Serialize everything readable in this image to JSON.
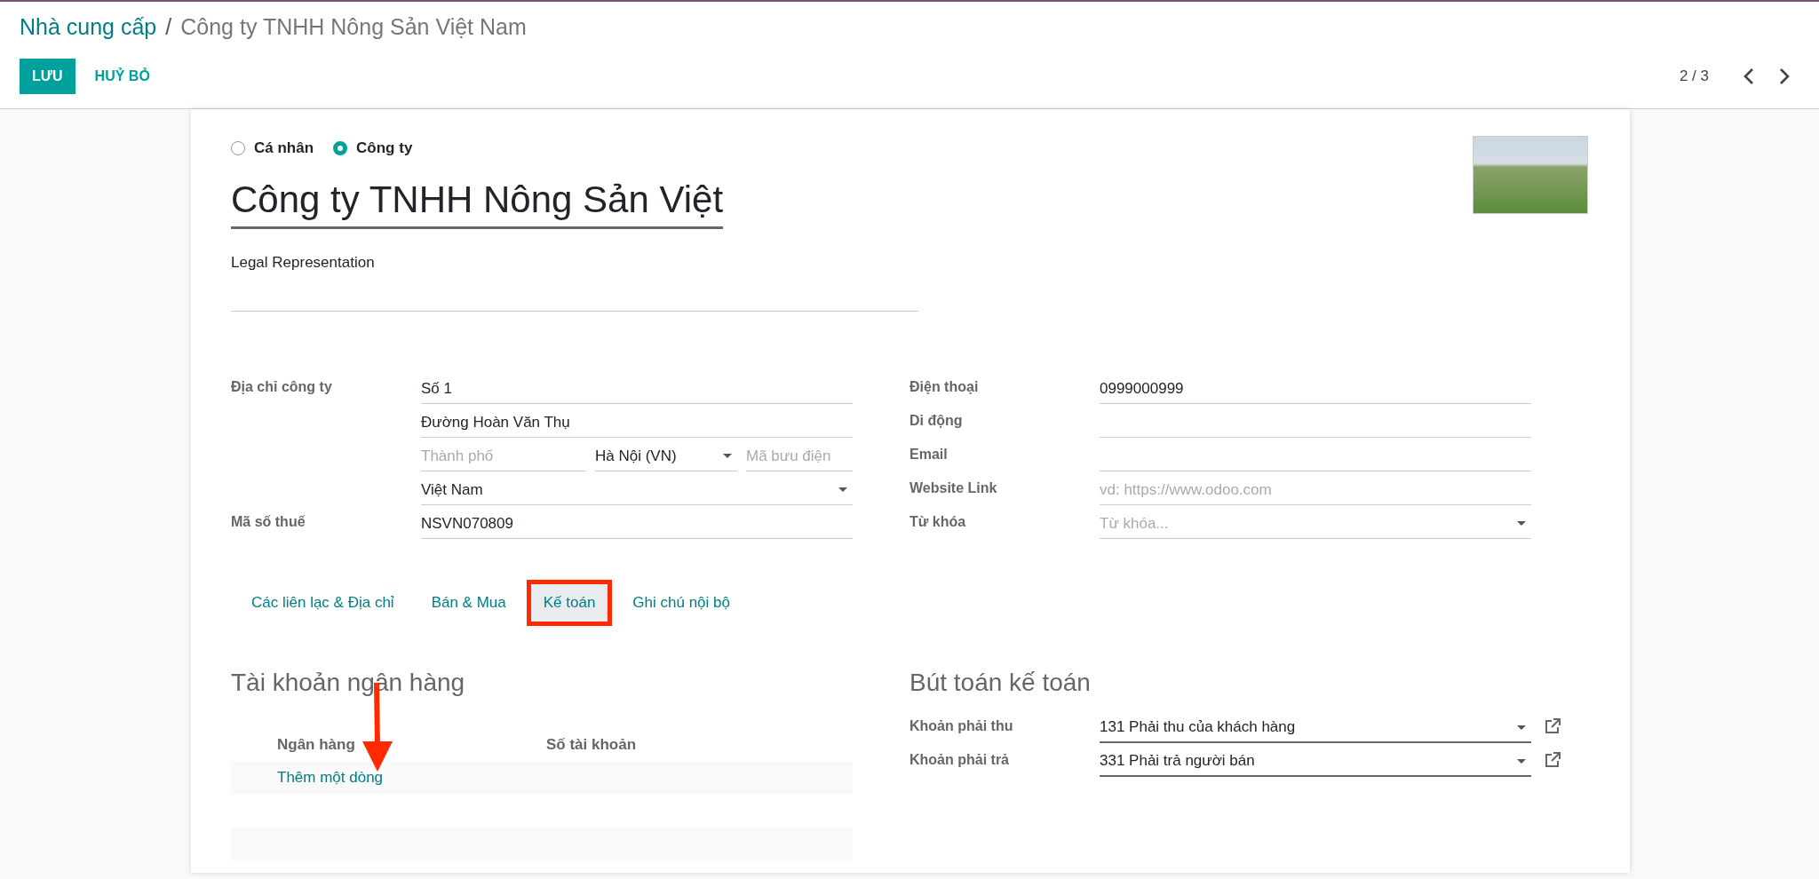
{
  "breadcrumb": {
    "parent": "Nhà cung cấp",
    "separator": "/",
    "current": "Công ty TNHH Nông Sản Việt Nam"
  },
  "buttons": [
    {
      "label": "LƯU",
      "kind": "primary"
    },
    {
      "label": "HUỶ BỎ",
      "kind": "link"
    }
  ],
  "pager": {
    "text": "2 / 3"
  },
  "company_type": [
    {
      "label": "Cá nhân",
      "selected": false
    },
    {
      "label": "Công ty",
      "selected": true
    }
  ],
  "name": "Công ty TNHH Nông Sản Việt",
  "legal_label": "Legal Representation",
  "address": {
    "label": "Địa chỉ công ty",
    "street": "Số 1",
    "street2": "Đường Hoàn Văn Thụ",
    "city_placeholder": "Thành phố",
    "state": "Hà Nội (VN)",
    "zip_placeholder": "Mã bưu điện",
    "country": "Việt Nam"
  },
  "vat": {
    "label": "Mã số thuế",
    "value": "NSVN070809"
  },
  "contact_fields": [
    {
      "label": "Điện thoại",
      "value": "0999000999",
      "kind": "text"
    },
    {
      "label": "Di động",
      "kind": "text"
    },
    {
      "label": "Email",
      "kind": "text"
    },
    {
      "label": "Website Link",
      "placeholder": "vd: https://www.odoo.com",
      "kind": "text"
    },
    {
      "label": "Từ khóa",
      "placeholder": "Từ khóa...",
      "kind": "select"
    }
  ],
  "tabs": [
    {
      "label": "Các liên lạc & Địa chỉ",
      "selected": false,
      "highlighted": false
    },
    {
      "label": "Bán & Mua",
      "selected": false,
      "highlighted": false
    },
    {
      "label": "Kế toán",
      "selected": true,
      "highlighted": true
    },
    {
      "label": "Ghi chú nội bộ",
      "selected": false,
      "highlighted": false
    }
  ],
  "bank": {
    "title": "Tài khoản ngân hàng",
    "columns": [
      "Ngân hàng",
      "Số tài khoản"
    ],
    "add_line": "Thêm một dòng"
  },
  "accounting": {
    "title": "Bút toán kế toán",
    "fields": [
      {
        "label": "Khoản phải thu",
        "value": "131 Phải thu của khách hàng"
      },
      {
        "label": "Khoản phải trả",
        "value": "331 Phải trả người bán"
      }
    ]
  }
}
